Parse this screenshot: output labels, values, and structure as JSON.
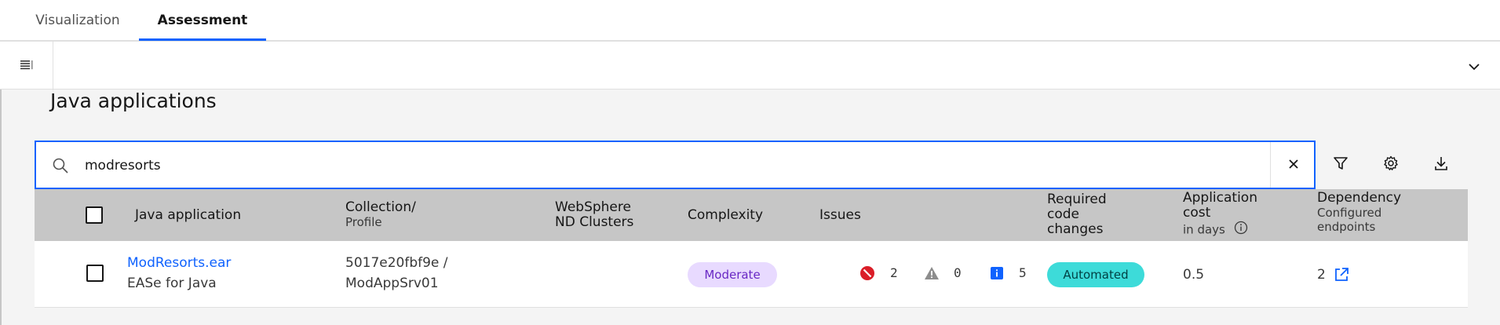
{
  "tabs": [
    {
      "label": "Visualization"
    },
    {
      "label": "Assessment"
    }
  ],
  "page": {
    "title": "Java applications"
  },
  "search": {
    "value": "modresorts",
    "placeholder": ""
  },
  "table": {
    "columns": {
      "java_application": "Java application",
      "collection": "Collection/",
      "collection_sub": "Profile",
      "websphere_1": "WebSphere",
      "websphere_2": "ND Clusters",
      "complexity": "Complexity",
      "issues": "Issues",
      "required_1": "Required",
      "required_2": "code",
      "required_3": "changes",
      "cost_1": "Application",
      "cost_2": "cost",
      "cost_sub": "in days",
      "dependency": "Dependency",
      "dependency_sub_1": "Configured",
      "dependency_sub_2": "endpoints"
    },
    "rows": [
      {
        "app_name": "ModResorts.ear",
        "app_sub": "EASe for Java",
        "collection_line1": "5017e20fbf9e /",
        "collection_line2": "ModAppSrv01",
        "complexity": "Moderate",
        "issues_critical": "2",
        "issues_warning": "0",
        "issues_info": "5",
        "required_code_changes": "Automated",
        "cost": "0.5",
        "dependency_endpoints": "2"
      }
    ]
  },
  "colors": {
    "accent": "#0f62fe",
    "critical": "#da1e28",
    "warning": "#8d8d8d",
    "info": "#0f62fe",
    "moderate_tag_bg": "#e8daff",
    "automated_tag_bg": "#3ddbd9"
  },
  "icons": {
    "list_toggle": "list-icon",
    "expand": "chevron-down-icon",
    "search": "search-icon",
    "clear": "close-icon",
    "filter": "filter-icon",
    "settings": "gear-icon",
    "download": "download-icon",
    "cost_info": "info-icon",
    "dependency_link": "external-link-icon"
  }
}
